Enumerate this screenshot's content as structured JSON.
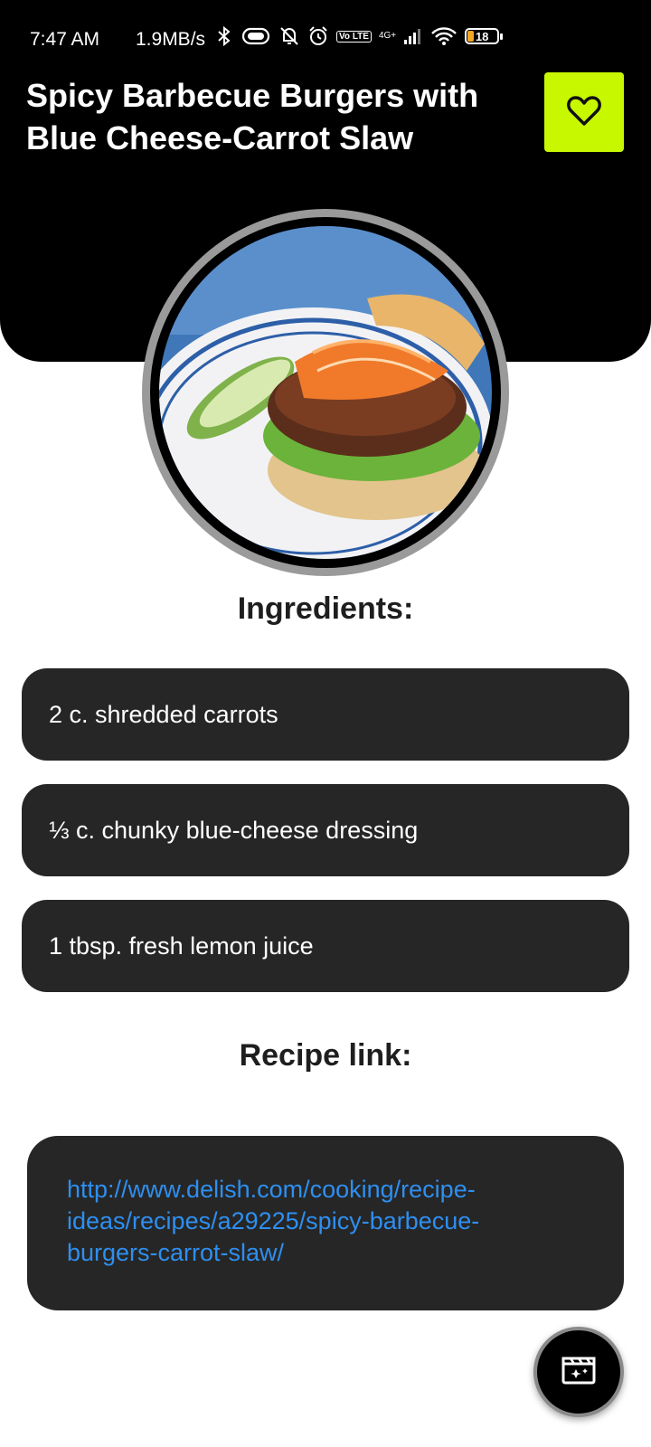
{
  "status_bar": {
    "time": "7:47 AM",
    "speed": "1.9MB/s",
    "volte": "Vo LTE",
    "network": "4G+",
    "battery": "18"
  },
  "recipe": {
    "title": "Spicy Barbecue Burgers with Blue Cheese-Carrot Slaw",
    "favorite_icon": "heart-outline-icon",
    "image_subject": "barbecue burger with carrot slaw and pickle on a plate"
  },
  "ingredients": {
    "heading": "Ingredients:",
    "items": [
      "2 c. shredded carrots",
      "⅓ c. chunky blue-cheese dressing",
      "1 tbsp. fresh lemon juice"
    ]
  },
  "recipe_link": {
    "heading": "Recipe link:",
    "url": "http://www.delish.com/cooking/recipe-ideas/recipes/a29225/spicy-barbecue-burgers-carrot-slaw/"
  },
  "fab": {
    "icon": "movie-clapper-icon"
  },
  "colors": {
    "header_bg": "#000000",
    "favorite_bg": "#c8f800",
    "card_bg": "#262626",
    "link": "#2e8ff0"
  }
}
